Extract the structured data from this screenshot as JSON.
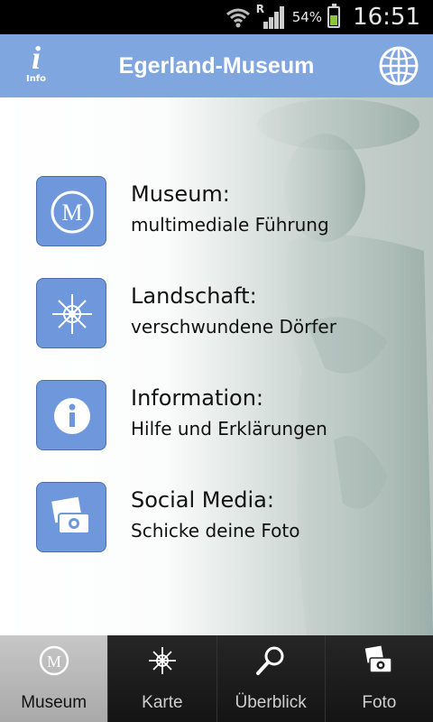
{
  "status_bar": {
    "battery_text": "54%",
    "roaming": "R",
    "time": "16:51"
  },
  "header": {
    "info_label": "Info",
    "title": "Egerland-Museum"
  },
  "menu": [
    {
      "title": "Museum:",
      "subtitle": "multimediale Führung",
      "icon": "museum-m-icon"
    },
    {
      "title": "Landschaft:",
      "subtitle": "verschwundene Dörfer",
      "icon": "compass-star-icon"
    },
    {
      "title": "Information:",
      "subtitle": "Hilfe und Erklärungen",
      "icon": "info-icon"
    },
    {
      "title": "Social Media:",
      "subtitle": "Schicke deine Foto",
      "icon": "camera-photo-icon"
    }
  ],
  "bottom_nav": [
    {
      "label": "Museum",
      "icon": "museum-m-icon",
      "active": true
    },
    {
      "label": "Karte",
      "icon": "compass-star-icon",
      "active": false
    },
    {
      "label": "Überblick",
      "icon": "magnifier-icon",
      "active": false
    },
    {
      "label": "Foto",
      "icon": "camera-photo-icon",
      "active": false
    }
  ],
  "colors": {
    "header": "#80a6e0",
    "tile": "#6f98dc",
    "battery": "#8ac43f"
  }
}
